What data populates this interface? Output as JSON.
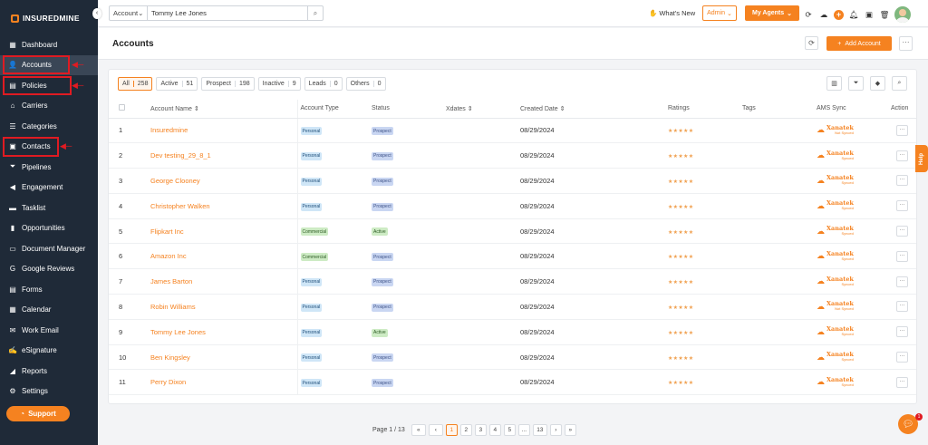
{
  "brand": {
    "name": "INSUREDMINE",
    "accent": "#f58220",
    "sidebar_bg": "#1f2a38",
    "highlight": "#e01b22"
  },
  "sidebar": {
    "collapse_icon": "chevron-left-icon",
    "items": [
      {
        "label": "Dashboard",
        "icon": "dashboard-icon",
        "glyph": "▦"
      },
      {
        "label": "Accounts",
        "icon": "user-icon",
        "glyph": "👤"
      },
      {
        "label": "Policies",
        "icon": "document-icon",
        "glyph": "▤"
      },
      {
        "label": "Carriers",
        "icon": "bank-icon",
        "glyph": "⌂"
      },
      {
        "label": "Categories",
        "icon": "list-icon",
        "glyph": "☰"
      },
      {
        "label": "Contacts",
        "icon": "contact-card-icon",
        "glyph": "▣"
      },
      {
        "label": "Pipelines",
        "icon": "filter-icon",
        "glyph": "⏷"
      },
      {
        "label": "Engagement",
        "icon": "megaphone-icon",
        "glyph": "◀"
      },
      {
        "label": "Tasklist",
        "icon": "checklist-icon",
        "glyph": "▬"
      },
      {
        "label": "Opportunities",
        "icon": "bar-chart-icon",
        "glyph": "▮"
      },
      {
        "label": "Document Manager",
        "icon": "folder-icon",
        "glyph": "▭"
      },
      {
        "label": "Google Reviews",
        "icon": "google-icon",
        "glyph": "G"
      },
      {
        "label": "Forms",
        "icon": "form-icon",
        "glyph": "▤"
      },
      {
        "label": "Calendar",
        "icon": "calendar-icon",
        "glyph": "▦"
      },
      {
        "label": "Work Email",
        "icon": "email-icon",
        "glyph": "✉"
      },
      {
        "label": "eSignature",
        "icon": "signature-icon",
        "glyph": "✍"
      },
      {
        "label": "Reports",
        "icon": "reports-icon",
        "glyph": "◢"
      },
      {
        "label": "Settings",
        "icon": "gear-icon",
        "glyph": "⚙"
      }
    ],
    "active_item": "Accounts",
    "support_label": "Support"
  },
  "topbar": {
    "search_type": "Account",
    "search_value": "Tommy Lee Jones",
    "whats_new": "What's New",
    "role": "Admin",
    "my_agents": "My Agents"
  },
  "header": {
    "title": "Accounts",
    "add_button": "Add Account"
  },
  "filters": [
    {
      "label": "All",
      "count": "258",
      "active": true
    },
    {
      "label": "Active",
      "count": "51",
      "active": false
    },
    {
      "label": "Prospect",
      "count": "198",
      "active": false
    },
    {
      "label": "Inactive",
      "count": "9",
      "active": false
    },
    {
      "label": "Leads",
      "count": "0",
      "active": false
    },
    {
      "label": "Others",
      "count": "0",
      "active": false
    }
  ],
  "table": {
    "columns": [
      "Account Name",
      "Account Type",
      "Status",
      "Xdates",
      "Created Date",
      "Ratings",
      "Tags",
      "AMS Sync",
      "Action"
    ],
    "rows": [
      {
        "num": "1",
        "name": "Insuredmine",
        "type": "Personal",
        "status": "Prospect",
        "date": "08/29/2024",
        "sync_note": "Not Synced"
      },
      {
        "num": "2",
        "name": "Dev testing_29_8_1",
        "type": "Personal",
        "status": "Prospect",
        "date": "08/29/2024",
        "sync_note": "Synced"
      },
      {
        "num": "3",
        "name": "George Clooney",
        "type": "Personal",
        "status": "Prospect",
        "date": "08/29/2024",
        "sync_note": "Synced"
      },
      {
        "num": "4",
        "name": "Christopher Walken",
        "type": "Personal",
        "status": "Prospect",
        "date": "08/29/2024",
        "sync_note": "Synced"
      },
      {
        "num": "5",
        "name": "Flipkart Inc",
        "type": "Commercial",
        "status": "Active",
        "date": "08/29/2024",
        "sync_note": "Synced"
      },
      {
        "num": "6",
        "name": "Amazon Inc",
        "type": "Commercial",
        "status": "Prospect",
        "date": "08/29/2024",
        "sync_note": "Synced"
      },
      {
        "num": "7",
        "name": "James Barton",
        "type": "Personal",
        "status": "Prospect",
        "date": "08/29/2024",
        "sync_note": "Synced"
      },
      {
        "num": "8",
        "name": "Robin Williams",
        "type": "Personal",
        "status": "Prospect",
        "date": "08/29/2024",
        "sync_note": "Not Synced"
      },
      {
        "num": "9",
        "name": "Tommy Lee Jones",
        "type": "Personal",
        "status": "Active",
        "date": "08/29/2024",
        "sync_note": "Synced"
      },
      {
        "num": "10",
        "name": "Ben Kingsley",
        "type": "Personal",
        "status": "Prospect",
        "date": "08/29/2024",
        "sync_note": "Synced"
      },
      {
        "num": "11",
        "name": "Perry Dixon",
        "type": "Personal",
        "status": "Prospect",
        "date": "08/29/2024",
        "sync_note": "Synced"
      }
    ],
    "stars": "★★★★★",
    "sync_brand": "Xanatek"
  },
  "pagination": {
    "label": "Page 1 / 13",
    "first": "«",
    "prev": "‹",
    "pages": [
      "1",
      "2",
      "3",
      "4",
      "5",
      "...",
      "13"
    ],
    "next": "›",
    "last": "»"
  },
  "help_label": "Help",
  "chat_badge": "1"
}
